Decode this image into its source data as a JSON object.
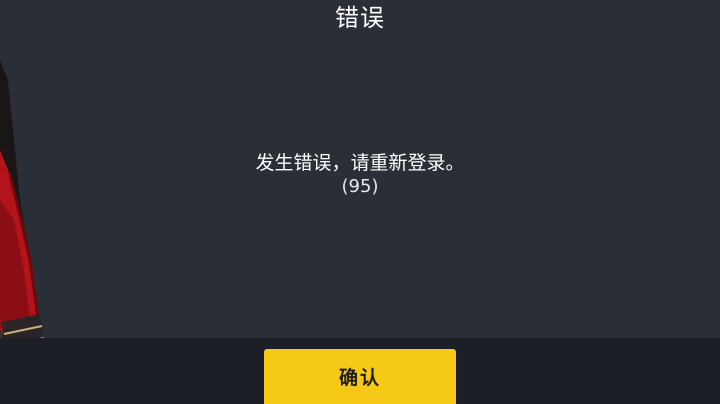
{
  "dialog": {
    "title": "错误",
    "message": "发生错误，请重新登录。",
    "error_code": "(95)",
    "confirm_label": "确认"
  },
  "colors": {
    "background": "#2a2f37",
    "footer": "#1c1f25",
    "button": "#f6c817",
    "text": "#ffffff"
  },
  "icons": {
    "character": "character-portrait"
  }
}
